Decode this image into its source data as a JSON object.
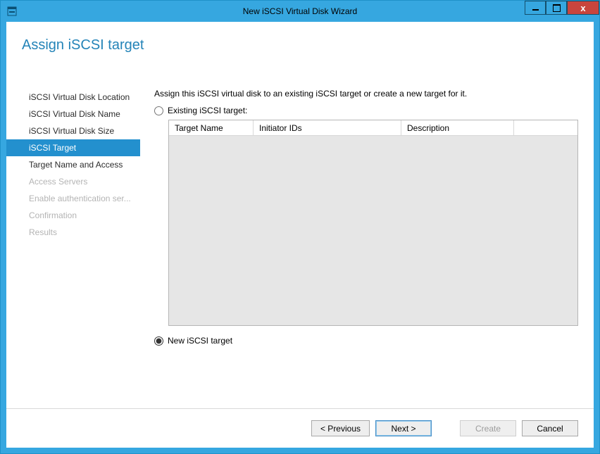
{
  "window": {
    "title": "New iSCSI Virtual Disk Wizard"
  },
  "heading": "Assign iSCSI target",
  "sidebar": {
    "items": [
      {
        "label": "iSCSI Virtual Disk Location",
        "state": "normal"
      },
      {
        "label": "iSCSI Virtual Disk Name",
        "state": "normal"
      },
      {
        "label": "iSCSI Virtual Disk Size",
        "state": "normal"
      },
      {
        "label": "iSCSI Target",
        "state": "selected"
      },
      {
        "label": "Target Name and Access",
        "state": "normal"
      },
      {
        "label": "Access Servers",
        "state": "disabled"
      },
      {
        "label": "Enable authentication ser...",
        "state": "disabled"
      },
      {
        "label": "Confirmation",
        "state": "disabled"
      },
      {
        "label": "Results",
        "state": "disabled"
      }
    ]
  },
  "main": {
    "instruction": "Assign this iSCSI virtual disk to an existing iSCSI target or create a new target for it.",
    "existing_radio_label": "Existing iSCSI target:",
    "new_radio_label": "New iSCSI target",
    "selected_radio": "new",
    "grid": {
      "columns": {
        "name": "Target Name",
        "initiators": "Initiator IDs",
        "description": "Description"
      },
      "rows": []
    }
  },
  "buttons": {
    "previous": "< Previous",
    "next": "Next >",
    "create": "Create",
    "cancel": "Cancel"
  }
}
